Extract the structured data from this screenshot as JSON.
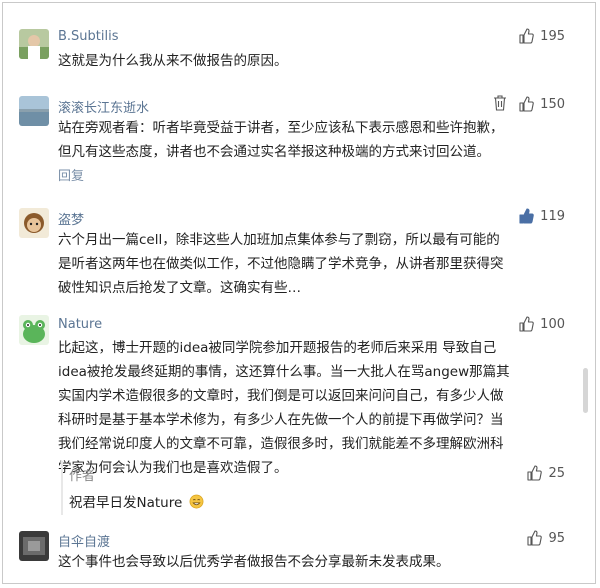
{
  "comments": [
    {
      "user": "B.Subtilis",
      "likes": "195",
      "text": [
        "这就是为什么我从来不做报告的原因。"
      ]
    },
    {
      "user": "滚滚长江东逝水",
      "likes": "150",
      "text": [
        "站在旁观者看：听者毕竟受益于讲者，至少应该私下表示感恩和些许抱歉，",
        "但凡有这些态度，讲者也不会通过实名举报这种极端的方式来讨回公道。"
      ],
      "reply": "回复"
    },
    {
      "user": "盗梦",
      "likes": "119",
      "text": [
        "六个月出一篇cell，除非这些人加班加点集体参与了剽窃，所以最有可能的",
        "是听者这两年也在做类似工作，不过他隐瞒了学术竞争，从讲者那里获得突",
        "破性知识点后抢发了文章。这确实有些…"
      ]
    },
    {
      "user": "Nature",
      "likes": "100",
      "text": [
        "比起这，博士开题的idea被同学院参加开题报告的老师后来采用 导致自己",
        "idea被抢发最终延期的事情，这还算什么事。当一大批人在骂angew那篇其",
        "实国内学术造假很多的文章时，我们倒是可以返回来问问自己，有多少人做",
        "科研时是基于基本学术修为，有多少人在先做一个人的前提下再做学问？当",
        "我们经常说印度人的文章不可靠，造假很多时，我们就能差不多理解欧洲科",
        "学家为何会认为我们也是喜欢造假了。"
      ],
      "author_reply": {
        "tag": "作者",
        "likes": "25",
        "text": "祝君早日发Nature"
      }
    },
    {
      "user": "自伞自渡",
      "likes": "95",
      "text": [
        "这个事件也会导致以后优秀学者做报告不会分享最新未发表成果。"
      ]
    }
  ],
  "colors": {
    "name": "#5b7593",
    "divider": "#e8e8e8"
  }
}
